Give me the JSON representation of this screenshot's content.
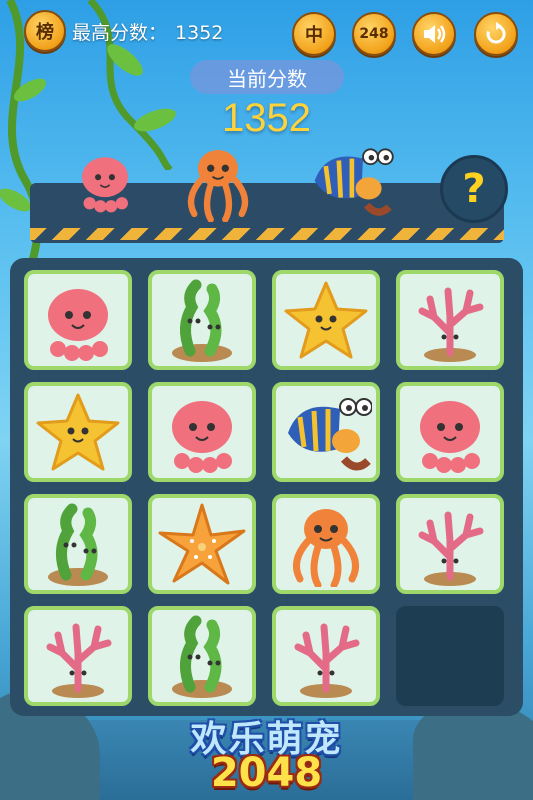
{
  "top_bar": {
    "rank_button_label": "榜",
    "best_score_label": "最高分数：",
    "best_score_value": "1352",
    "difficulty_button_label": "中",
    "mode_button_label": "248"
  },
  "score": {
    "current_label": "当前分数",
    "current_value": "1352"
  },
  "help_label": "?",
  "board": {
    "rows": [
      [
        "octopus-pink",
        "seaweed",
        "starfish-smile",
        "coral"
      ],
      [
        "starfish-smile",
        "octopus-pink",
        "hermit-crab",
        "octopus-pink"
      ],
      [
        "seaweed",
        "starfish-orange",
        "octopus-orange",
        "coral"
      ],
      [
        "coral",
        "seaweed",
        "coral",
        "empty"
      ]
    ]
  },
  "shelf_creatures": [
    "octopus-pink",
    "octopus-orange",
    "hermit-crab"
  ],
  "logo": {
    "title": "欢乐萌宠",
    "subtitle": "2048"
  },
  "colors": {
    "board_bg": "#2b4d66",
    "tile_bg": "#dff3e8",
    "tile_border": "#9ed86a",
    "score_color": "#ffd23a",
    "button_gold": "#f2a119"
  }
}
